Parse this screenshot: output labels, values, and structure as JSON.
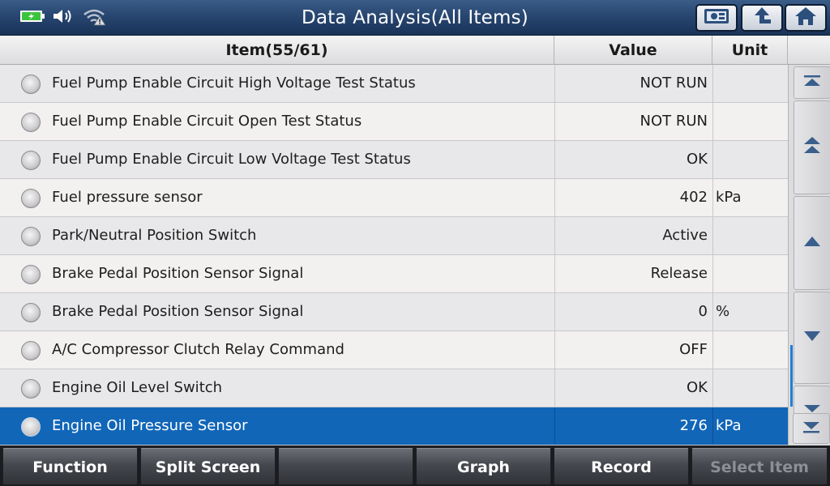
{
  "title": "Data Analysis(All Items)",
  "header": {
    "item_label": "Item(55/61)",
    "value_label": "Value",
    "unit_label": "Unit"
  },
  "rows": [
    {
      "name": "Fuel Pump Enable Circuit High Voltage Test Status",
      "value": "NOT RUN",
      "unit": ""
    },
    {
      "name": "Fuel Pump Enable Circuit Open Test Status",
      "value": "NOT RUN",
      "unit": ""
    },
    {
      "name": "Fuel Pump Enable Circuit Low Voltage Test Status",
      "value": "OK",
      "unit": ""
    },
    {
      "name": "Fuel pressure sensor",
      "value": "402",
      "unit": "kPa"
    },
    {
      "name": "Park/Neutral Position Switch",
      "value": "Active",
      "unit": ""
    },
    {
      "name": "Brake Pedal Position Sensor Signal",
      "value": "Release",
      "unit": ""
    },
    {
      "name": "Brake Pedal Position Sensor Signal",
      "value": "0",
      "unit": "%"
    },
    {
      "name": "A/C Compressor Clutch Relay Command",
      "value": "OFF",
      "unit": ""
    },
    {
      "name": "Engine Oil Level Switch",
      "value": "OK",
      "unit": ""
    },
    {
      "name": "Engine Oil Pressure Sensor",
      "value": "276",
      "unit": "kPa"
    }
  ],
  "selected_row": 9,
  "toolbar": {
    "function": "Function",
    "split_screen": "Split Screen",
    "blank": "",
    "graph": "Graph",
    "record": "Record",
    "select_item": "Select Item"
  },
  "status_icons": [
    "battery-charging-icon",
    "speaker-icon",
    "wifi-warning-icon"
  ],
  "title_buttons": [
    "screenshot-icon",
    "back-icon",
    "home-icon"
  ],
  "colors": {
    "selection": "#1166b8",
    "title_bar": "#274670",
    "scroll_indicator": "#1f7fd6"
  }
}
